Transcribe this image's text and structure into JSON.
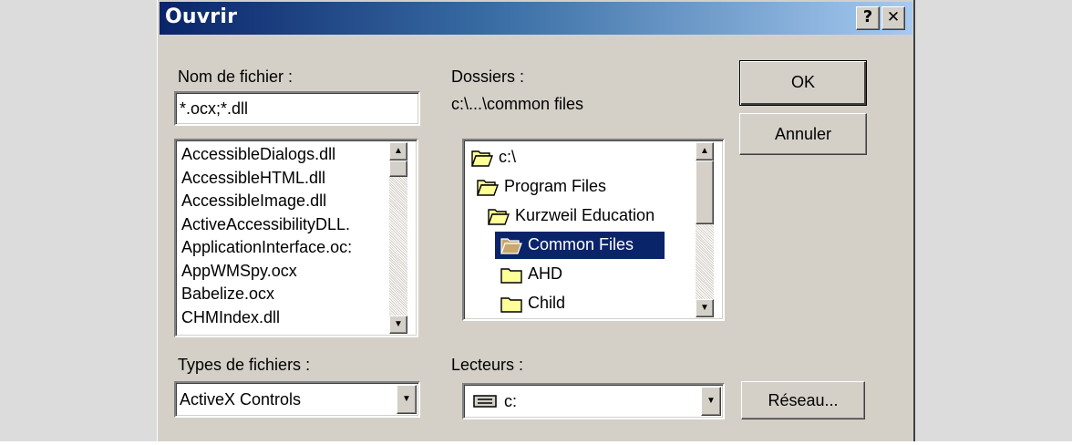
{
  "window": {
    "title": "Ouvrir",
    "help_label": "?",
    "close_label": "✕"
  },
  "filename": {
    "label": "Nom de fichier :",
    "value": "*.ocx;*.dll"
  },
  "files": [
    "AccessibleDialogs.dll",
    "AccessibleHTML.dll",
    "AccessibleImage.dll",
    "ActiveAccessibilityDLL.",
    "ApplicationInterface.oc:",
    "AppWMSpy.ocx",
    "Babelize.ocx",
    "CHMIndex.dll"
  ],
  "folders": {
    "label": "Dossiers :",
    "current_path": "c:\\...\\common files",
    "items": [
      {
        "name": "c:\\",
        "icon": "open-folder-icon",
        "selected": false
      },
      {
        "name": "Program Files",
        "icon": "open-folder-icon",
        "selected": false
      },
      {
        "name": "Kurzweil Education",
        "icon": "open-folder-icon",
        "selected": false
      },
      {
        "name": "Common Files",
        "icon": "open-folder-icon",
        "selected": true
      },
      {
        "name": "AHD",
        "icon": "folder-icon",
        "selected": false
      },
      {
        "name": "Child",
        "icon": "folder-icon",
        "selected": false
      }
    ]
  },
  "file_types": {
    "label": "Types de fichiers :",
    "value": "ActiveX Controls"
  },
  "drives": {
    "label": "Lecteurs :",
    "value": "c:",
    "icon": "drive-icon"
  },
  "buttons": {
    "ok": "OK",
    "cancel": "Annuler",
    "network": "Réseau..."
  },
  "colors": {
    "title_start": "#0a246a",
    "title_end": "#a6caf0",
    "face": "#d4d0c8",
    "selection": "#0a246a",
    "folder_yellow": "#ffff99"
  }
}
